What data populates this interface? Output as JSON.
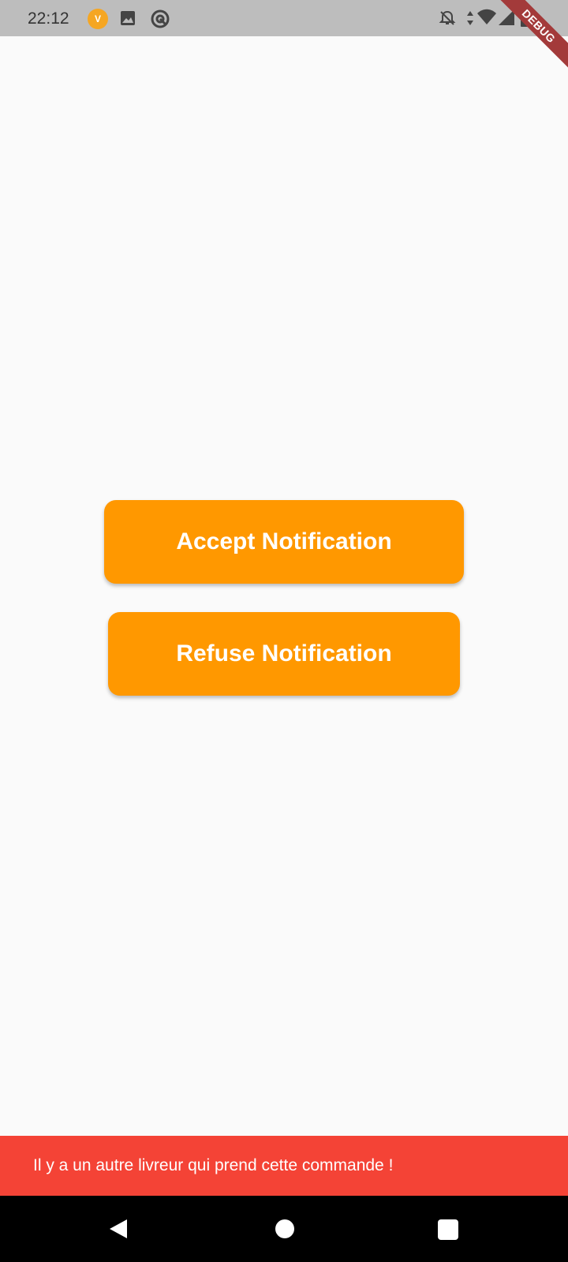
{
  "status_bar": {
    "time": "22:12",
    "app_badge_text": "V",
    "icons": [
      "app-badge-icon",
      "gallery-icon",
      "sync-icon",
      "bell-off-icon",
      "data-arrows-icon",
      "wifi-icon",
      "signal-icon",
      "battery-icon"
    ]
  },
  "debug_banner": {
    "label": "DEBUG"
  },
  "buttons": {
    "accept_label": "Accept Notification",
    "refuse_label": "Refuse Notification"
  },
  "snackbar": {
    "message": "Il y a un autre livreur qui prend cette commande !"
  },
  "colors": {
    "accent": "#ff9800",
    "snackbar_bg": "#f44336",
    "status_bar_bg": "#bdbdbd",
    "background": "#fafafa",
    "debug_banner": "#a33a3a"
  },
  "nav_bar": {
    "icons": [
      "back-icon",
      "home-icon",
      "recents-icon"
    ]
  }
}
